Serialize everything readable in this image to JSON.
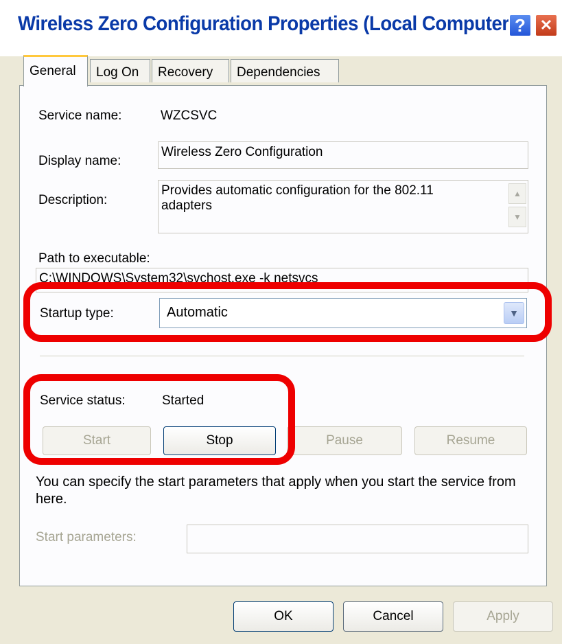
{
  "window": {
    "title": "Wireless Zero Configuration Properties (Local Computer)",
    "help_glyph": "?",
    "close_glyph": "✕"
  },
  "tabs": [
    {
      "label": "General"
    },
    {
      "label": "Log On"
    },
    {
      "label": "Recovery"
    },
    {
      "label": "Dependencies"
    }
  ],
  "general": {
    "service_name_label": "Service name:",
    "service_name_value": "WZCSVC",
    "display_name_label": "Display name:",
    "display_name_value": "Wireless Zero Configuration",
    "description_label": "Description:",
    "description_value": "Provides automatic configuration for the 802.11 adapters",
    "path_label": "Path to executable:",
    "path_value": "C:\\WINDOWS\\System32\\svchost.exe -k netsvcs",
    "startup_type_label": "Startup type:",
    "startup_type_value": "Automatic",
    "service_status_label": "Service status:",
    "service_status_value": "Started",
    "start_button": "Start",
    "stop_button": "Stop",
    "pause_button": "Pause",
    "resume_button": "Resume",
    "hint_text": "You can specify the start parameters that apply when you start the service from here.",
    "start_parameters_label": "Start parameters:",
    "start_parameters_value": ""
  },
  "footer": {
    "ok_button": "OK",
    "cancel_button": "Cancel",
    "apply_button": "Apply"
  },
  "colors": {
    "highlight": "#ee0000",
    "title_text": "#0a3aa8",
    "dialog_bg": "#ECE9D8"
  },
  "icons": {
    "scroll_up": "up-arrow-icon",
    "scroll_down": "down-arrow-icon",
    "dropdown": "chevron-down-icon"
  }
}
